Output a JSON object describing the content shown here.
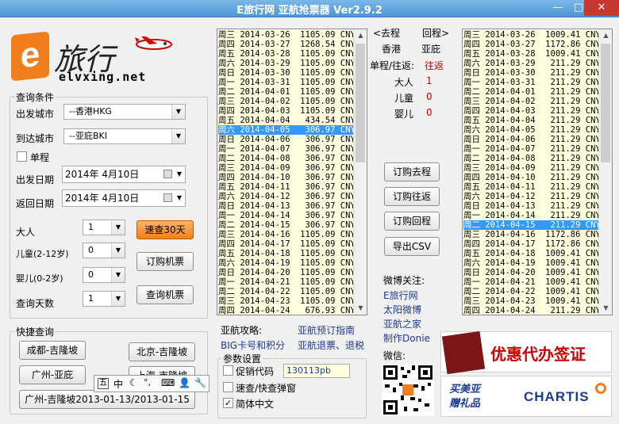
{
  "window": {
    "title": "E旅行网 亚航抢票器  Ver2.9.2"
  },
  "logo": {
    "cn": "旅行",
    "url": "elvxing.net"
  },
  "query": {
    "group_label": "查询条件",
    "from_label": "出发城市",
    "from_value": "--香港HKG",
    "to_label": "到达城市",
    "to_value": "--亚庇BKI",
    "oneway_label": "单程",
    "depart_label": "出发日期",
    "depart_value": "2014年 4月10日",
    "return_label": "返回日期",
    "return_value": "2014年 4月10日",
    "adult_label": "大人",
    "adult_value": "1",
    "child_label": "儿童(2-12岁)",
    "child_value": "0",
    "infant_label": "婴儿(0-2岁)",
    "infant_value": "0",
    "days_label": "查询天数",
    "days_value": "1",
    "quick30_label": "速查30天",
    "book_label": "订购机票",
    "search_label": "查询机票"
  },
  "quick": {
    "group_label": "快捷查询",
    "b1": "成都-吉隆坡",
    "b2": "北京-吉隆坡",
    "b3": "广州-亚庇",
    "b4": "上海-吉隆坡",
    "b5": "广州-吉隆坡2013-01-13/2013-01-15"
  },
  "ime": {
    "items": [
      "五",
      "中",
      "☾",
      "°,",
      "⌨",
      "👤",
      "🔧"
    ]
  },
  "outbound": {
    "rows": [
      {
        "t": "周三 2014-03-26  1105.09 CNY  ",
        "s": ""
      },
      {
        "t": "周四 2014-03-27  1268.54 CNY  ",
        "s": ""
      },
      {
        "t": "周五 2014-03-28  1105.09 CNY  ",
        "s": ""
      },
      {
        "t": "周六 2014-03-29  1105.09 CNY  ",
        "s": ""
      },
      {
        "t": "周日 2014-03-30  1105.09 CNY  ",
        "s": ""
      },
      {
        "t": "周一 2014-03-31  1105.09 CNY  ",
        "s": ""
      },
      {
        "t": "周二 2014-04-01  1105.09 CNY  ",
        "s": ""
      },
      {
        "t": "周三 2014-04-02  1105.09 CNY  ",
        "s": ""
      },
      {
        "t": "周四 2014-04-03  1105.09 CNY  ",
        "s": ""
      },
      {
        "t": "周五 2014-04-04   434.54 CNY  ",
        "s": ""
      },
      {
        "t": "周六 2014-04-05   306.97 CNY *",
        "s": "sel"
      },
      {
        "t": "周日 2014-04-06   306.97 CNY *",
        "s": ""
      },
      {
        "t": "周一 2014-04-07   306.97 CNY *",
        "s": ""
      },
      {
        "t": "周二 2014-04-08   306.97 CNY *",
        "s": ""
      },
      {
        "t": "周三 2014-04-09   306.97 CNY *",
        "s": ""
      },
      {
        "t": "周四 2014-04-10   306.97 CNY *",
        "s": ""
      },
      {
        "t": "周五 2014-04-11   306.97 CNY *",
        "s": ""
      },
      {
        "t": "周六 2014-04-12   306.97 CNY *",
        "s": ""
      },
      {
        "t": "周日 2014-04-13   306.97 CNY *",
        "s": ""
      },
      {
        "t": "周一 2014-04-14   306.97 CNY *",
        "s": ""
      },
      {
        "t": "周二 2014-04-15   306.97 CNY *",
        "s": ""
      },
      {
        "t": "周三 2014-04-16  1105.09 CNY  ",
        "s": ""
      },
      {
        "t": "周四 2014-04-17  1105.09 CNY  ",
        "s": ""
      },
      {
        "t": "周五 2014-04-18  1105.09 CNY  ",
        "s": ""
      },
      {
        "t": "周六 2014-04-19  1105.09 CNY  ",
        "s": ""
      },
      {
        "t": "周日 2014-04-20  1105.09 CNY  ",
        "s": ""
      },
      {
        "t": "周一 2014-04-21  1105.09 CNY  ",
        "s": ""
      },
      {
        "t": "周二 2014-04-22  1105.09 CNY  ",
        "s": ""
      },
      {
        "t": "周三 2014-04-23  1105.09 CNY  ",
        "s": ""
      },
      {
        "t": "周四 2014-04-24   676.93 CNY  ",
        "s": ""
      }
    ]
  },
  "inbound": {
    "rows": [
      {
        "t": "周三 2014-03-26  1009.41 CNY  ",
        "s": ""
      },
      {
        "t": "周四 2014-03-27  1172.86 CNY  ",
        "s": ""
      },
      {
        "t": "周五 2014-03-28  1009.41 CNY  ",
        "s": ""
      },
      {
        "t": "周六 2014-03-29   211.29 CNY *",
        "s": ""
      },
      {
        "t": "周日 2014-03-30   211.29 CNY *",
        "s": ""
      },
      {
        "t": "周一 2014-03-31   211.29 CNY *",
        "s": ""
      },
      {
        "t": "周二 2014-04-01   211.29 CNY *",
        "s": ""
      },
      {
        "t": "周三 2014-04-02   211.29 CNY *",
        "s": ""
      },
      {
        "t": "周四 2014-04-03   211.29 CNY *",
        "s": ""
      },
      {
        "t": "周五 2014-04-04   211.29 CNY *",
        "s": ""
      },
      {
        "t": "周六 2014-04-05   211.29 CNY *",
        "s": ""
      },
      {
        "t": "周日 2014-04-06   211.29 CNY *",
        "s": ""
      },
      {
        "t": "周一 2014-04-07   211.29 CNY *",
        "s": ""
      },
      {
        "t": "周二 2014-04-08   211.29 CNY *",
        "s": ""
      },
      {
        "t": "周三 2014-04-09   211.29 CNY *",
        "s": ""
      },
      {
        "t": "周四 2014-04-10   211.29 CNY *",
        "s": ""
      },
      {
        "t": "周五 2014-04-11   211.29 CNY *",
        "s": ""
      },
      {
        "t": "周六 2014-04-12   211.29 CNY *",
        "s": ""
      },
      {
        "t": "周日 2014-04-13   211.29 CNY *",
        "s": ""
      },
      {
        "t": "周一 2014-04-14   211.29 CNY *",
        "s": ""
      },
      {
        "t": "周二 2014-04-15   211.29 CNY *",
        "s": "sel"
      },
      {
        "t": "周三 2014-04-16  1172.86 CNY  ",
        "s": ""
      },
      {
        "t": "周四 2014-04-17  1172.86 CNY  ",
        "s": ""
      },
      {
        "t": "周五 2014-04-18  1009.41 CNY  ",
        "s": ""
      },
      {
        "t": "周六 2014-04-19  1009.41 CNY  ",
        "s": ""
      },
      {
        "t": "周日 2014-04-20  1009.41 CNY  ",
        "s": ""
      },
      {
        "t": "周一 2014-04-21  1009.41 CNY  ",
        "s": ""
      },
      {
        "t": "周二 2014-04-22  1009.41 CNY  ",
        "s": ""
      },
      {
        "t": "周三 2014-04-23  1009.41 CNY  ",
        "s": ""
      },
      {
        "t": "周四 2014-04-24   211.29 CNY *",
        "s": ""
      }
    ]
  },
  "middle": {
    "out_label": "<去程",
    "ret_label": "回程>",
    "out_city": "香港",
    "ret_city": "亚庇",
    "trip_label": "单程/往返:",
    "trip_value": "往返",
    "adult_label": "大人",
    "adult_value": "1",
    "child_label": "儿童",
    "child_value": "0",
    "infant_label": "婴儿",
    "infant_value": "0",
    "btn_out": "订购去程",
    "btn_both": "订购往返",
    "btn_ret": "订购回程",
    "btn_csv": "导出CSV",
    "weibo_label": "微博关注:",
    "weibo_links": [
      "E旅行网",
      "太阳微博",
      "亚航之家",
      "制作Donie"
    ],
    "wechat_label": "微信:"
  },
  "links": {
    "l1": "亚航攻略:",
    "l2": "亚航预订指南",
    "l3": "BIG卡号和积分",
    "l4": "亚航退票、退税"
  },
  "params": {
    "group_label": "参数设置",
    "promo_label": "促销代码",
    "promo_value": "130113pb",
    "quick_label": "速查/快查弹窗",
    "simp_label": "简体中文"
  },
  "ads": {
    "visa": "优惠代办签证",
    "gift": "买美亚 赠礼品",
    "chartis": "CHARTIS"
  },
  "colors": {
    "accent": "#3399ff",
    "row_bg": "#ffffe0",
    "brand_orange": "#f07e1b",
    "link": "#1b3b95"
  }
}
